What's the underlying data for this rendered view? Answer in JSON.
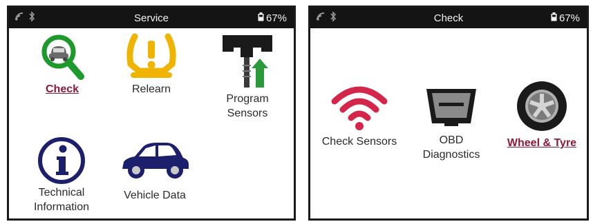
{
  "left_screen": {
    "title": "Service",
    "battery": "67%",
    "icons": {
      "signal": "signal-icon",
      "bluetooth": "bluetooth-icon",
      "battery": "battery-icon"
    },
    "tiles": [
      {
        "label": "Check",
        "icon": "magnifier-car-icon",
        "selected": true
      },
      {
        "label": "Relearn",
        "icon": "tpms-warning-icon",
        "selected": false
      },
      {
        "label": "Program Sensors",
        "line1": "Program",
        "line2": "Sensors",
        "icon": "program-sensor-icon",
        "selected": false
      },
      {
        "label": "Technical Information",
        "line1": "Technical",
        "line2": "Information",
        "icon": "info-icon",
        "selected": false
      },
      {
        "label": "Vehicle Data",
        "icon": "car-icon",
        "selected": false
      }
    ]
  },
  "right_screen": {
    "title": "Check",
    "battery": "67%",
    "icons": {
      "signal": "signal-icon",
      "bluetooth": "bluetooth-icon",
      "battery": "battery-icon"
    },
    "tiles": [
      {
        "label": "Check Sensors",
        "icon": "wireless-signal-icon",
        "selected": false
      },
      {
        "label": "OBD Diagnostics",
        "line1": "OBD",
        "line2": "Diagnostics",
        "icon": "obd-connector-icon",
        "selected": false
      },
      {
        "label": "Wheel & Tyre",
        "icon": "wheel-icon",
        "selected": true
      }
    ]
  },
  "colors": {
    "statusbar": "#141414",
    "selected_label": "#8a1a3a",
    "check_green": "#1e9a2c",
    "warning_amber": "#f0b400",
    "info_navy": "#1c1f6b",
    "signal_red": "#d3264a",
    "program_green": "#2a9a3a"
  }
}
